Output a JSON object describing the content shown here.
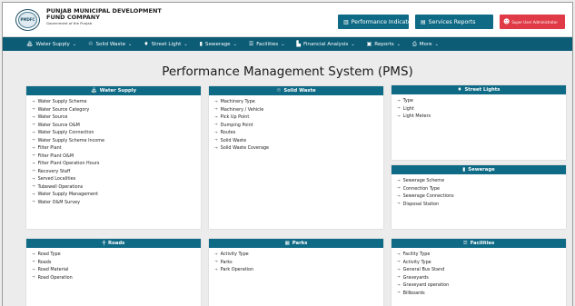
{
  "header": {
    "org_line1": "PUNJAB MUNICIPAL DEVELOPMENT",
    "org_line2": "FUND COMPANY",
    "org_line3": "Government of the Punjab",
    "logo_text": "PMDFC",
    "buttons": {
      "performance": "Performance Indicator",
      "services": "Services Reports",
      "admin": "Super User Administrator"
    },
    "icons": {
      "performance": "chart-icon",
      "services": "report-icon",
      "admin": "users-icon"
    }
  },
  "nav": {
    "items": [
      {
        "label": "Water Supply",
        "icon": "faucet-icon",
        "glyph": "⛲"
      },
      {
        "label": "Solid Waste",
        "icon": "recycle-icon",
        "glyph": "♲"
      },
      {
        "label": "Street Light",
        "icon": "lamp-icon",
        "glyph": "♦"
      },
      {
        "label": "Sewerage",
        "icon": "pipe-icon",
        "glyph": "▮"
      },
      {
        "label": "Facilities",
        "icon": "list-icon",
        "glyph": "☰"
      },
      {
        "label": "Financial Analysis",
        "icon": "finance-icon",
        "glyph": "▙"
      },
      {
        "label": "Reports",
        "icon": "report-icon",
        "glyph": "▣"
      },
      {
        "label": "More",
        "icon": "printer-icon",
        "glyph": "⎙"
      }
    ]
  },
  "page_title": "Performance Management System (PMS)",
  "cards": {
    "water_supply": {
      "title": "Water Supply",
      "items": [
        "Water Supply Scheme",
        "Water Source Category",
        "Water Source",
        "Water Source O&M",
        "Water Supply Connection",
        "Water Supply Scheme Income",
        "Filter Plant",
        "Filter Plant O&M",
        "Filter Plant Operation Hours",
        "Recovery Staff",
        "Served Localities",
        "Tubewell Operations",
        "Water Supply Management",
        "Water O&M Survey"
      ]
    },
    "solid_waste": {
      "title": "Solid Waste",
      "items": [
        "Machinery Type",
        "Machinery / Vehicle",
        "Pick Up Point",
        "Dumping Point",
        "Routes",
        "Solid Waste",
        "Solid Waste Coverage"
      ]
    },
    "street_lights": {
      "title": "Street Lights",
      "items": [
        "Type",
        "Light",
        "Light Meters"
      ]
    },
    "sewerage": {
      "title": "Sewerage",
      "items": [
        "Sewerage Scheme",
        "Connection Type",
        "Sewerage Connections",
        "Disposal Station"
      ]
    },
    "roads": {
      "title": "Roads",
      "items": [
        "Road Type",
        "Roads",
        "Road Material",
        "Road Operation"
      ]
    },
    "parks": {
      "title": "Parks",
      "items": [
        "Activity Type",
        "Parks",
        "Park Operation"
      ]
    },
    "facilities": {
      "title": "Facilities",
      "items": [
        "Facility Type",
        "Activity Type",
        "General Bus Stand",
        "Graveyards",
        "Graveyard operation",
        "Billboards"
      ]
    }
  },
  "colors": {
    "primary": "#0f6a85",
    "nav": "#0c5c76",
    "danger": "#e03a47",
    "background": "#ececec"
  }
}
